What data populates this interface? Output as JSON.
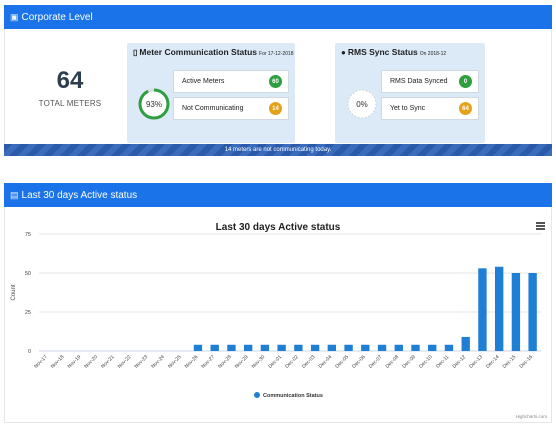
{
  "corporate": {
    "header": "Corporate Level",
    "total_value": "64",
    "total_label": "TOTAL METERS",
    "meter_card": {
      "title": "Meter Communication Status",
      "subtitle": "For 17-12-2018",
      "gauge_label": "93%",
      "gauge_fraction": 0.93,
      "rows": [
        {
          "label": "Active Meters",
          "value": "60",
          "color": "#2e9e3e"
        },
        {
          "label": "Not Communicating",
          "value": "14",
          "color": "#e3a21a"
        }
      ]
    },
    "rms_card": {
      "title": "RMS Sync Status",
      "subtitle": "On 2018-12",
      "gauge_label": "0%",
      "gauge_fraction": 0,
      "rows": [
        {
          "label": "RMS Data Synced",
          "value": "0",
          "color": "#2e9e3e"
        },
        {
          "label": "Yet to Sync",
          "value": "64",
          "color": "#e3a21a"
        }
      ]
    },
    "alert": "14 meters are not communicating today."
  },
  "active": {
    "header": "Last 30 days Active status",
    "credits": "Highcharts.com"
  },
  "colors": {
    "header": "#1a73e8",
    "bar": "#1f7fd4"
  },
  "icons": {
    "header_icon": "monitor-icon",
    "meter_icon": "phone-icon",
    "rms_icon": "user-icon",
    "chart_icon": "bar-chart-icon",
    "menu_icon": "hamburger-menu-icon"
  },
  "chart_data": {
    "type": "bar",
    "title": "Last 30 days Active status",
    "ylabel": "Count",
    "xlabel": "",
    "ylim": [
      0,
      75
    ],
    "yticks": [
      0,
      25,
      50,
      75
    ],
    "grid": true,
    "legend_position": "bottom-center",
    "categories": [
      "Nov-17",
      "Nov-18",
      "Nov-19",
      "Nov-20",
      "Nov-21",
      "Nov-22",
      "Nov-23",
      "Nov-24",
      "Nov-25",
      "Nov-26",
      "Nov-27",
      "Nov-28",
      "Nov-29",
      "Nov-30",
      "Dec-01",
      "Dec-02",
      "Dec-03",
      "Dec-04",
      "Dec-05",
      "Dec-06",
      "Dec-07",
      "Dec-08",
      "Dec-09",
      "Dec-10",
      "Dec-11",
      "Dec-12",
      "Dec-13",
      "Dec-14",
      "Dec-15",
      "Dec-16"
    ],
    "series": [
      {
        "name": "Communication Status",
        "values": [
          0,
          0,
          0,
          0,
          0,
          0,
          0,
          0,
          0,
          4,
          4,
          4,
          4,
          4,
          4,
          4,
          4,
          4,
          4,
          4,
          4,
          4,
          4,
          4,
          4,
          9,
          53,
          54,
          50,
          50
        ]
      }
    ]
  }
}
